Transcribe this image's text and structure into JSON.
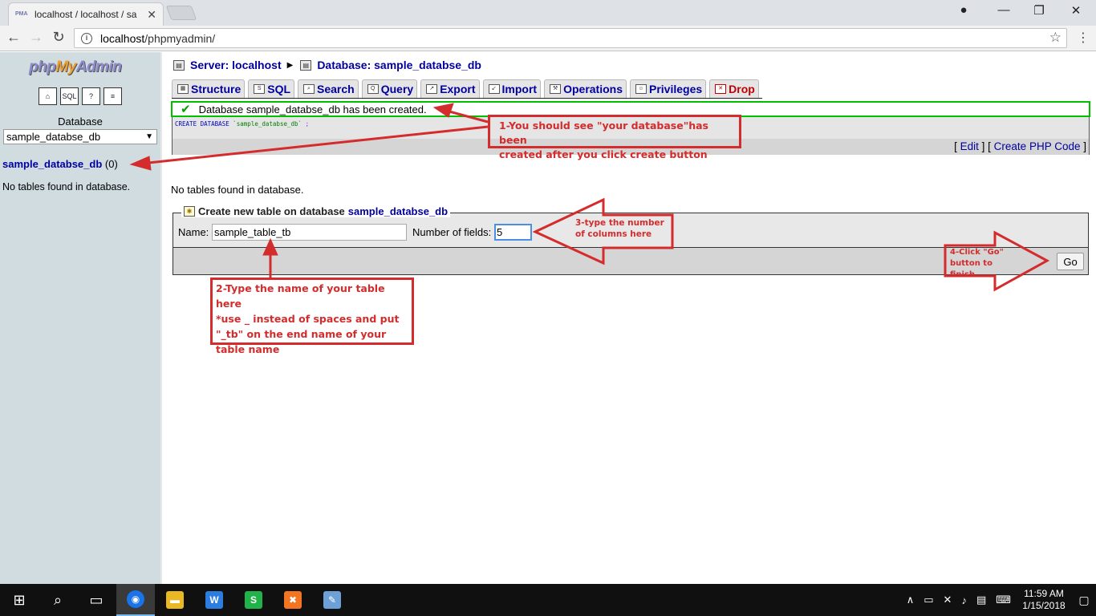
{
  "browser": {
    "tab_title": "localhost / localhost / sa",
    "favicon_text": "PMA",
    "url_host": "localhost",
    "url_path": "/phpmyadmin/",
    "window_controls": [
      "user-icon",
      "minimize-icon",
      "restore-icon",
      "close-icon"
    ]
  },
  "sidebar": {
    "logo_php": "php",
    "logo_my": "My",
    "logo_admin": "Admin",
    "icons": [
      "home-icon",
      "sql-query-icon",
      "query-window-icon",
      "docs-icon"
    ],
    "icon_glyphs": [
      "⌂",
      "SQL",
      "?",
      "≡"
    ],
    "database_label": "Database",
    "selected_database": "sample_databse_db",
    "db_link": "sample_databse_db",
    "db_count": "(0)",
    "no_tables": "No tables found in database."
  },
  "breadcrumb": {
    "server": "Server: localhost",
    "database": "Database: sample_databse_db"
  },
  "tabs": [
    {
      "label": "Structure",
      "icon": "structure-icon"
    },
    {
      "label": "SQL",
      "icon": "sql-icon"
    },
    {
      "label": "Search",
      "icon": "search-icon"
    },
    {
      "label": "Query",
      "icon": "query-icon"
    },
    {
      "label": "Export",
      "icon": "export-icon"
    },
    {
      "label": "Import",
      "icon": "import-icon"
    },
    {
      "label": "Operations",
      "icon": "operations-icon"
    },
    {
      "label": "Privileges",
      "icon": "privileges-icon"
    },
    {
      "label": "Drop",
      "icon": "drop-icon"
    }
  ],
  "message": {
    "success": "Database sample_databse_db has been created.",
    "sql_kw": "CREATE DATABASE",
    "sql_str": "`sample_databse_db`",
    "sql_end": ";",
    "edit_link": "Edit",
    "create_php_link": "Create PHP Code"
  },
  "main": {
    "no_tables": "No tables found in database."
  },
  "create_table": {
    "legend": "Create new table on database",
    "legend_db": "sample_databse_db",
    "name_label": "Name:",
    "name_value": "sample_table_tb",
    "fields_label": "Number of fields:",
    "fields_value": "5",
    "go_label": "Go"
  },
  "annotations": {
    "a1_line1": "1-You should see \"your database\"has been",
    "a1_line2": "created after you click create button",
    "a2_line1": "2-Type the name of your table here",
    "a2_line2": "*use _ instead of spaces and put",
    "a2_line3": "\"_tb\" on the end name of your",
    "a2_line4": "table name",
    "a3_line1": "3-type the number",
    "a3_line2": "of columns here",
    "a4_line1": "4-Click \"Go\"",
    "a4_line2": "button to finish",
    "color": "#d42c2c"
  },
  "taskbar": {
    "items": [
      "windows-start-icon",
      "search-icon",
      "task-view-icon",
      "chrome-icon",
      "file-explorer-icon",
      "wps-writer-icon",
      "wps-spreadsheet-icon",
      "xampp-icon",
      "paint-icon"
    ],
    "time": "11:59 AM",
    "date": "1/15/2018"
  }
}
